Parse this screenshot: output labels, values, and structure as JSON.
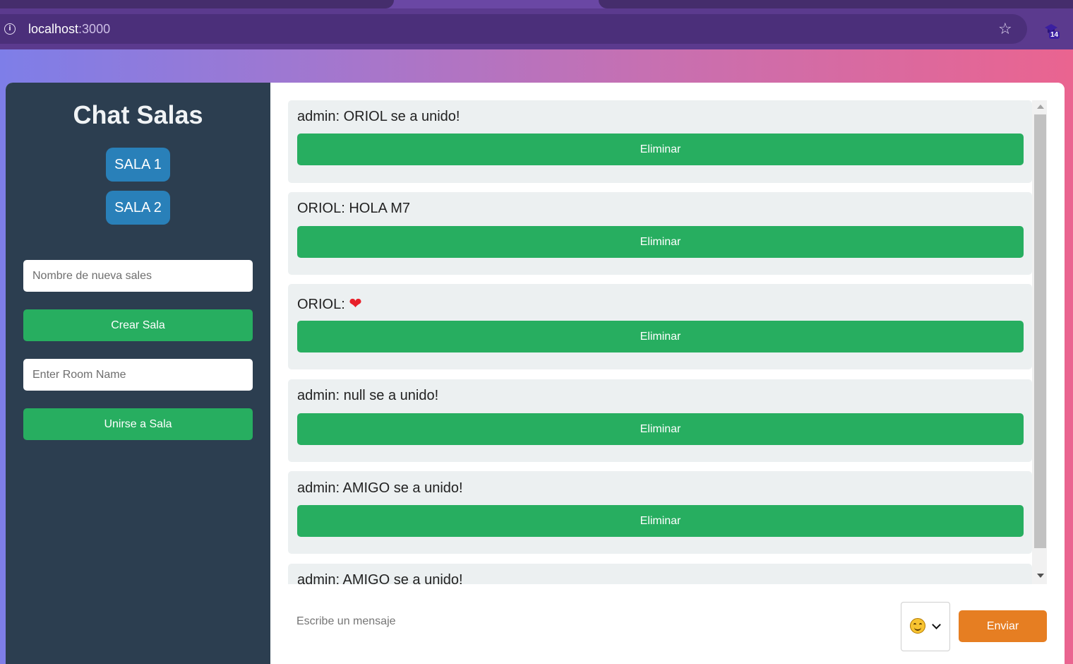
{
  "browser": {
    "url_host": "localhost",
    "url_port": ":3000",
    "extension_badge": "14"
  },
  "sidebar": {
    "title": "Chat Salas",
    "rooms": [
      {
        "label": "SALA 1"
      },
      {
        "label": "SALA 2"
      }
    ],
    "new_room_placeholder": "Nombre de nueva sales",
    "create_button": "Crear Sala",
    "join_placeholder": "Enter Room Name",
    "join_button": "Unirse a Sala"
  },
  "messages": [
    {
      "text": "admin: ORIOL se a unido!",
      "delete_label": "Eliminar"
    },
    {
      "text": "ORIOL: HOLA M7",
      "delete_label": "Eliminar"
    },
    {
      "text": "ORIOL: ",
      "emoji": "❤",
      "delete_label": "Eliminar"
    },
    {
      "text": "admin: null se a unido!",
      "delete_label": "Eliminar"
    },
    {
      "text": "admin: AMIGO se a unido!",
      "delete_label": "Eliminar"
    },
    {
      "text": "admin: AMIGO se a unido!"
    }
  ],
  "composer": {
    "placeholder": "Escribe un mensaje",
    "selected_emoji": "smiling-face",
    "send_button": "Enviar"
  },
  "colors": {
    "sidebar_bg": "#2c3e50",
    "room_button": "#2980b9",
    "action_green": "#27ae60",
    "send_orange": "#e67e22",
    "message_bg": "#ecf0f1"
  }
}
